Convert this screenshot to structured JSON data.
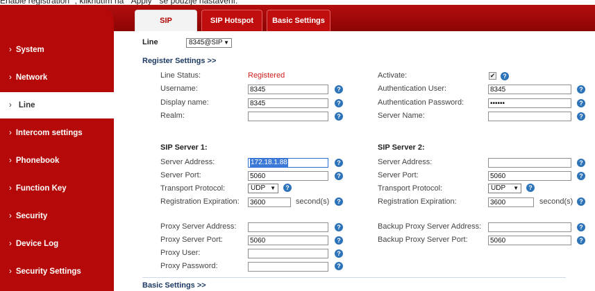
{
  "caption": "Enable registration\" , kliknutím na \" Apply \" se použije nastavení.",
  "tabs": [
    "SIP",
    "SIP Hotspot",
    "Basic Settings"
  ],
  "sidebar": [
    {
      "label": "System"
    },
    {
      "label": "Network"
    },
    {
      "label": "Line"
    },
    {
      "label": "Intercom settings"
    },
    {
      "label": "Phonebook"
    },
    {
      "label": "Function Key"
    },
    {
      "label": "Security"
    },
    {
      "label": "Device Log"
    },
    {
      "label": "Security Settings"
    }
  ],
  "line": {
    "label": "Line",
    "value": "8345@SIP"
  },
  "register_settings": {
    "title": "Register Settings >>",
    "line_status_label": "Line Status:",
    "line_status_value": "Registered",
    "activate_label": "Activate:",
    "username_label": "Username:",
    "username_value": "8345",
    "auth_user_label": "Authentication User:",
    "auth_user_value": "8345",
    "display_name_label": "Display name:",
    "display_name_value": "8345",
    "auth_password_label": "Authentication Password:",
    "auth_password_value": "••••••",
    "realm_label": "Realm:",
    "realm_value": "",
    "server_name_label": "Server Name:",
    "server_name_value": ""
  },
  "sip_server_1": {
    "title": "SIP Server 1:",
    "address_label": "Server Address:",
    "address_value": "172.18.1.88",
    "port_label": "Server Port:",
    "port_value": "5060",
    "transport_label": "Transport Protocol:",
    "transport_value": "UDP",
    "expiration_label": "Registration Expiration:",
    "expiration_value": "3600",
    "expiration_unit": "second(s)"
  },
  "sip_server_2": {
    "title": "SIP Server 2:",
    "address_label": "Server Address:",
    "address_value": "",
    "port_label": "Server Port:",
    "port_value": "5060",
    "transport_label": "Transport Protocol:",
    "transport_value": "UDP",
    "expiration_label": "Registration Expiration:",
    "expiration_value": "3600",
    "expiration_unit": "second(s)"
  },
  "proxy": {
    "address_label": "Proxy Server Address:",
    "address_value": "",
    "port_label": "Proxy Server Port:",
    "port_value": "5060",
    "user_label": "Proxy User:",
    "user_value": "",
    "password_label": "Proxy Password:",
    "password_value": "",
    "backup_address_label": "Backup Proxy Server Address:",
    "backup_address_value": "",
    "backup_port_label": "Backup Proxy Server Port:",
    "backup_port_value": "5060"
  },
  "basic_settings_title": "Basic Settings >>",
  "help_glyph": "?",
  "check_glyph": "✔"
}
